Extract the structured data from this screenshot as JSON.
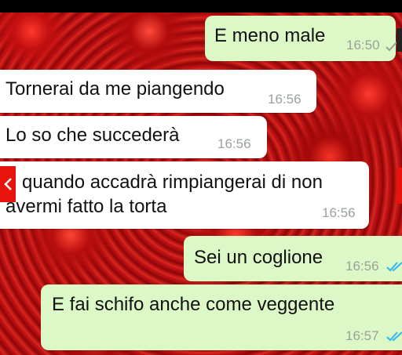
{
  "conversation": {
    "messages": [
      {
        "direction": "outgoing",
        "text": "E meno male",
        "time": "16:50",
        "status": "sent"
      },
      {
        "direction": "incoming",
        "text": "Tornerai da me piangendo",
        "time": "16:56"
      },
      {
        "direction": "incoming",
        "text": "Lo so che succederà",
        "time": "16:56"
      },
      {
        "direction": "incoming",
        "text_line1": "quando accadrà rimpiangerai di non",
        "text_line2": "avermi fatto la torta",
        "time": "16:56"
      },
      {
        "direction": "outgoing",
        "text": "Sei un coglione",
        "time": "16:56",
        "status": "read"
      },
      {
        "direction": "outgoing",
        "text": "E fai schifo anche come veggente",
        "time": "16:57",
        "status": "read"
      }
    ]
  },
  "colors": {
    "outgoing_bubble": "#dcf8c6",
    "incoming_bubble": "#ffffff",
    "read_tick": "#34b7f1",
    "sent_tick": "#9aa19a",
    "wallpaper": "#b30f12"
  },
  "icons": {
    "left_edge": "chevron-left-icon",
    "ticks": "double-check-icon"
  }
}
